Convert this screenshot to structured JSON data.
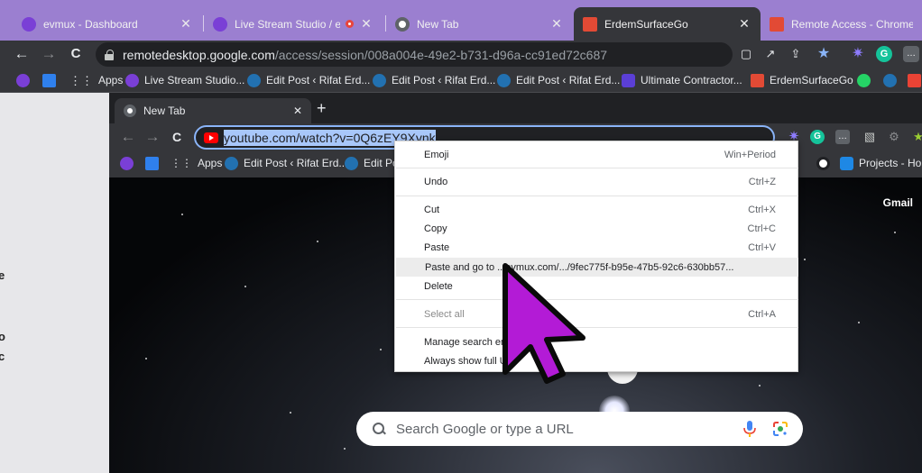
{
  "outer_tabs": [
    {
      "title": "evmux - Dashboard",
      "close": "✕",
      "color": "#7a3fd6"
    },
    {
      "title": "Live Stream Studio / evmu",
      "close": "✕",
      "color": "#7a3fd6"
    },
    {
      "title": "New Tab",
      "close": "✕",
      "color": "#5f6368"
    },
    {
      "title": "ErdemSurfaceGo",
      "close": "✕",
      "color": "#e24a35"
    },
    {
      "title": "Remote Access - Chrome Rem",
      "close": "",
      "color": "#e24a35"
    }
  ],
  "outer_toolbar": {
    "back": "←",
    "forward": "→",
    "reload": "C",
    "url_host": "remotedesktop.google.com",
    "url_path": "/access/session/008a004e-49e2-b731-d96a-cc91ed72c687",
    "icons": [
      "clipboard-icon",
      "open-external-icon",
      "share-icon",
      "star-icon",
      "extension-icon",
      "grammarly-icon",
      "more-icon"
    ]
  },
  "outer_bookmarks": [
    {
      "label": "Apps",
      "icon": "apps-grid-icon",
      "color": "#e8eaed"
    },
    {
      "label": "Live Stream Studio...",
      "icon": "evmux-icon",
      "color": "#7a3fd6"
    },
    {
      "label": "Edit Post ‹ Rifat Erd...",
      "icon": "wordpress-icon",
      "color": "#2271b1"
    },
    {
      "label": "Edit Post ‹ Rifat Erd...",
      "icon": "wordpress-icon",
      "color": "#2271b1"
    },
    {
      "label": "Edit Post ‹ Rifat Erd...",
      "icon": "wordpress-icon",
      "color": "#2271b1"
    },
    {
      "label": "Ultimate Contractor...",
      "icon": "contractor-icon",
      "color": "#5b3fd6"
    },
    {
      "label": "ErdemSurfaceGo",
      "icon": "remote-icon",
      "color": "#e24a35"
    }
  ],
  "inner_tab": {
    "title": "New Tab",
    "close": "✕",
    "new_tab": "+"
  },
  "inner_toolbar": {
    "back": "←",
    "forward": "→",
    "reload": "C",
    "url_selected": "youtube.com/watch?v=0Q6zEY9Xynk"
  },
  "inner_bookmarks": [
    {
      "label": "Apps"
    },
    {
      "label": "Edit Post ‹ Rifat Erd..."
    },
    {
      "label": "Edit Pos"
    },
    {
      "label": "Projects - Hom"
    }
  ],
  "newtab_page": {
    "gmail": "Gmail",
    "search_placeholder": "Search Google or type a URL"
  },
  "context_menu": {
    "items": [
      {
        "label": "Emoji",
        "shortcut": "Win+Period"
      },
      {
        "label": "Undo",
        "shortcut": "Ctrl+Z"
      },
      {
        "label": "Cut",
        "shortcut": "Ctrl+X"
      },
      {
        "label": "Copy",
        "shortcut": "Ctrl+C"
      },
      {
        "label": "Paste",
        "shortcut": "Ctrl+V"
      },
      {
        "label": "Paste and go to ...evmux.com/.../9fec775f-b95e-47b5-92c6-630bb57...",
        "shortcut": ""
      },
      {
        "label": "Delete",
        "shortcut": ""
      },
      {
        "label": "Select all",
        "shortcut": "Ctrl+A"
      },
      {
        "label": "Manage search eng",
        "shortcut": ""
      },
      {
        "label": "Always show full U",
        "shortcut": ""
      }
    ]
  },
  "colors": {
    "outer_frame": "#9b7fd0",
    "cursor": "#b31bd6",
    "selection": "#a8c7fa"
  }
}
